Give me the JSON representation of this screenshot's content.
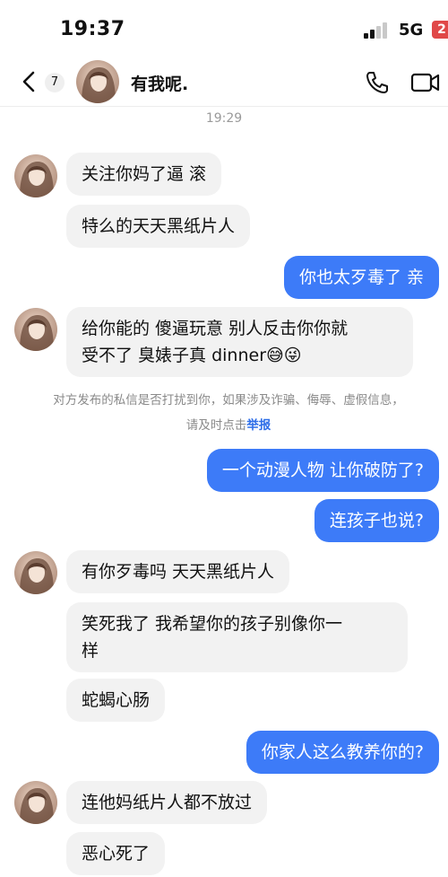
{
  "status_bar": {
    "time": "19:37",
    "network": "5G",
    "battery": "2"
  },
  "header": {
    "unread_count": "7",
    "contact_name": "有我呢."
  },
  "timestamp": "19:29",
  "messages": [
    {
      "side": "in",
      "text": "关注你妈了逼 滚"
    },
    {
      "side": "in",
      "text": "特么的天天黑纸片人"
    },
    {
      "side": "out",
      "text": "你也太歹毒了 亲"
    },
    {
      "side": "in",
      "text": "给你能的 傻逼玩意 别人反击你你就\n受不了 臭婊子真 dinner😅😜"
    },
    {
      "side": "out",
      "text": "一个动漫人物 让你破防了?"
    },
    {
      "side": "out",
      "text": "连孩子也说?"
    },
    {
      "side": "in",
      "text": "有你歹毒吗 天天黑纸片人"
    },
    {
      "side": "in",
      "text": "笑死我了 我希望你的孩子别像你一\n样"
    },
    {
      "side": "in",
      "text": "蛇蝎心肠"
    },
    {
      "side": "out",
      "text": "你家人这么教养你的?"
    },
    {
      "side": "in",
      "text": "连他妈纸片人都不放过"
    },
    {
      "side": "in",
      "text": "恶心死了"
    }
  ],
  "notice": {
    "text": "对方发布的私信是否打扰到你，如果涉及诈骗、侮辱、虚假信息，请及时点击",
    "link": "举报"
  },
  "colors": {
    "outgoing": "#3d7bf8",
    "incoming": "#f2f2f2",
    "report_link": "#2f6fe8"
  }
}
